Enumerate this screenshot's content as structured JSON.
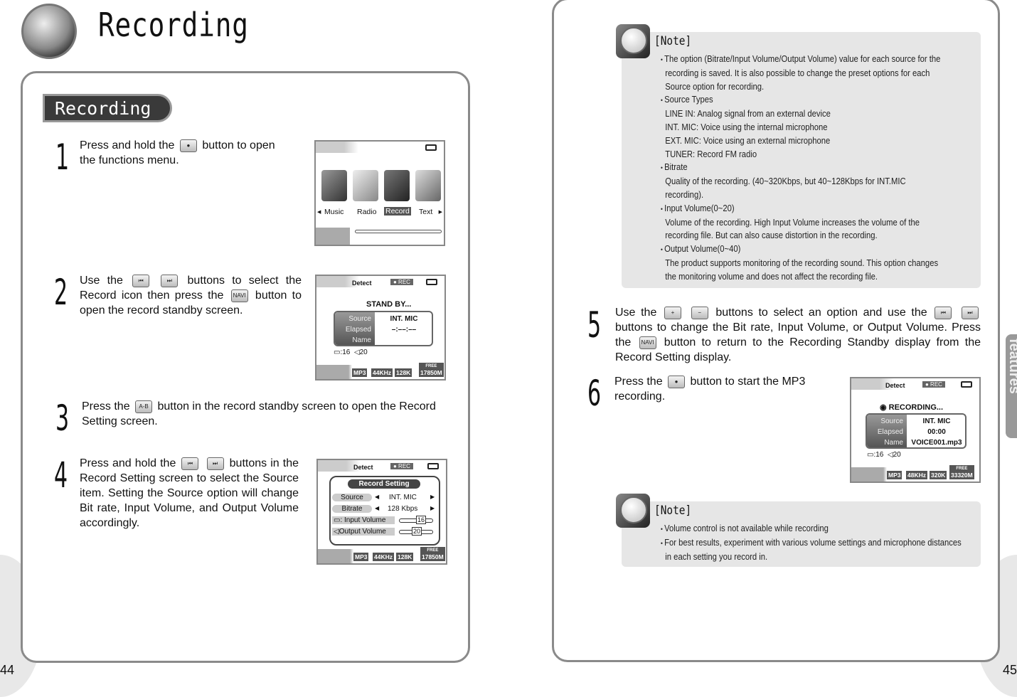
{
  "left_page": {
    "title": "Recording",
    "section": "Recording",
    "page_number": "44",
    "steps": [
      {
        "num": "1",
        "segments": [
          {
            "t": "Press and hold the"
          },
          {
            "btn": "●",
            "name": "rec-button-icon"
          },
          {
            "t": "button to open the functions menu."
          }
        ]
      },
      {
        "num": "2",
        "segments": [
          {
            "t": "Use the"
          },
          {
            "btn": "⏮",
            "name": "prev-button-icon"
          },
          {
            "btn": "⏭",
            "name": "next-button-icon"
          },
          {
            "t": "buttons to select the Record icon then press the"
          },
          {
            "btn": "NAVI",
            "name": "navi-button-icon"
          },
          {
            "t": "button to open the record standby screen."
          }
        ]
      },
      {
        "num": "3",
        "segments": [
          {
            "t": "Press the"
          },
          {
            "btn": "A-B",
            "name": "ab-button-icon"
          },
          {
            "t": "button in the record standby screen to open the Record Setting screen."
          }
        ]
      },
      {
        "num": "4",
        "segments": [
          {
            "t": "Press and hold the"
          },
          {
            "btn": "⏮",
            "name": "prev-button-icon"
          },
          {
            "btn": "⏭",
            "name": "next-button-icon"
          },
          {
            "t": "buttons in the Record Setting screen to select the Source item. Setting the Source option will change Bit rate, Input Volume, and Output Volume accordingly."
          }
        ]
      }
    ],
    "screen_menu": {
      "items": [
        "Music",
        "Radio",
        "Record",
        "Text"
      ],
      "selected": "Record"
    },
    "screen_standby": {
      "detect": "Detect",
      "rec": "● REC",
      "status": "STAND BY...",
      "labels": [
        "Source",
        "Elapsed",
        "Name"
      ],
      "values": [
        "INT. MIC",
        "–:––:––",
        ""
      ],
      "input_vol": ":16",
      "output_vol": "20",
      "tags": [
        "MP3",
        "44KHz",
        "128K"
      ],
      "free_label": "FREE",
      "free": "17850M"
    },
    "screen_setting": {
      "detect": "Detect",
      "rec": "● REC",
      "title": "Record Setting",
      "rows": [
        {
          "label": "Source",
          "value": "INT. MIC"
        },
        {
          "label": "Bitrate",
          "value": "128 Kbps"
        }
      ],
      "input_label": ": Input Volume",
      "input_value": "16",
      "output_label": "Output Volume",
      "output_value": "20",
      "tags": [
        "MP3",
        "44KHz",
        "128K"
      ],
      "free_label": "FREE",
      "free": "17850M"
    }
  },
  "right_page": {
    "page_number": "45",
    "side_tab": "Useful features",
    "note1": {
      "title": "[Note]",
      "lines": [
        {
          "k": "b",
          "t": "The option (Bitrate/Input Volume/Output Volume) value for each source for the"
        },
        {
          "k": "i",
          "t": "recording is saved. It is also possible to change the preset options for each"
        },
        {
          "k": "i",
          "t": "Source option for recording."
        },
        {
          "k": "b",
          "t": "Source Types"
        },
        {
          "k": "i",
          "t": "LINE IN: Analog signal from an external device"
        },
        {
          "k": "i",
          "t": "INT. MIC: Voice using the internal microphone"
        },
        {
          "k": "i",
          "t": "EXT. MIC: Voice using an external microphone"
        },
        {
          "k": "i",
          "t": "TUNER: Record FM radio"
        },
        {
          "k": "b",
          "t": "Bitrate"
        },
        {
          "k": "i",
          "t": "Quality of the recording. (40~320Kbps, but 40~128Kbps for INT.MIC"
        },
        {
          "k": "i",
          "t": "recording)."
        },
        {
          "k": "b",
          "t": "Input Volume(0~20)"
        },
        {
          "k": "i",
          "t": "Volume of the recording. High Input Volume increases the volume of the"
        },
        {
          "k": "i",
          "t": "recording file. But can also cause distortion in the recording."
        },
        {
          "k": "b",
          "t": "Output Volume(0~40)"
        },
        {
          "k": "i",
          "t": "The product supports monitoring of the recording sound. This option changes"
        },
        {
          "k": "i",
          "t": "the monitoring volume and does not affect the recording file."
        }
      ]
    },
    "steps": [
      {
        "num": "5",
        "segments": [
          {
            "t": "Use the"
          },
          {
            "btn": "+",
            "name": "plus-button-icon"
          },
          {
            "btn": "−",
            "name": "minus-button-icon"
          },
          {
            "t": "buttons to select an option and use the"
          },
          {
            "btn": "⏮",
            "name": "prev-button-icon"
          },
          {
            "btn": "⏭",
            "name": "next-button-icon"
          },
          {
            "t": "buttons to change the Bit rate, Input Volume, or Output Volume. Press the"
          },
          {
            "btn": "NAVI",
            "name": "navi-button-icon"
          },
          {
            "t": "button to return to the Recording Standby display from the Record Setting display."
          }
        ]
      },
      {
        "num": "6",
        "segments": [
          {
            "t": "Press the"
          },
          {
            "btn": "●",
            "name": "rec-button-icon"
          },
          {
            "t": "button to start the MP3 recording."
          }
        ]
      }
    ],
    "screen_recording": {
      "detect": "Detect",
      "rec": "● REC",
      "status": "RECORDING...",
      "labels": [
        "Source",
        "Elapsed",
        "Name"
      ],
      "values": [
        "INT. MIC",
        "00:00",
        "VOICE001.mp3"
      ],
      "input_vol": ":16",
      "output_vol": "20",
      "tags": [
        "MP3",
        "48KHz",
        "320K"
      ],
      "free_label": "FREE",
      "free": "33320M"
    },
    "note2": {
      "title": "[Note]",
      "lines": [
        {
          "k": "b",
          "t": "Volume control is not available while recording"
        },
        {
          "k": "b",
          "t": "For best results, experiment with various volume settings and microphone distances"
        },
        {
          "k": "i",
          "t": "in each setting you record in."
        }
      ]
    }
  }
}
